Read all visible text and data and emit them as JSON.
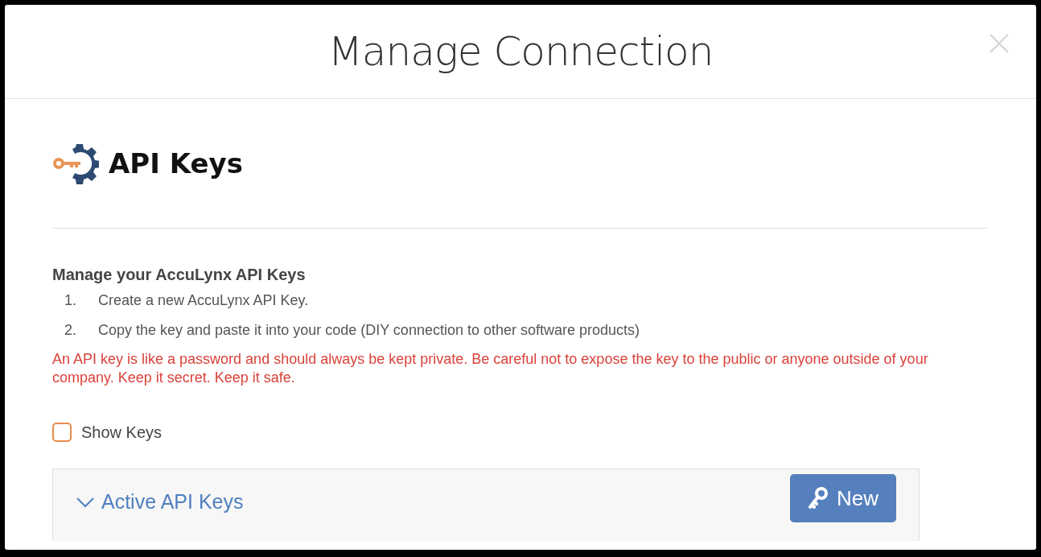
{
  "dialog": {
    "title": "Manage Connection"
  },
  "section": {
    "heading": "API Keys"
  },
  "instructions": {
    "title": "Manage your AccuLynx API Keys",
    "steps": [
      {
        "number": "1.",
        "text": "Create a new AccuLynx API Key."
      },
      {
        "number": "2.",
        "text": "Copy the key and paste it into your code (DIY connection to other software products)"
      }
    ],
    "warning": "An API key is like a password and should always be kept private. Be careful not to expose the key to the public or anyone outside of your company. Keep it secret. Keep it safe."
  },
  "show_keys": {
    "label": "Show Keys",
    "checked": false
  },
  "panel": {
    "title": "Active API Keys",
    "expanded": true,
    "button": "New"
  }
}
